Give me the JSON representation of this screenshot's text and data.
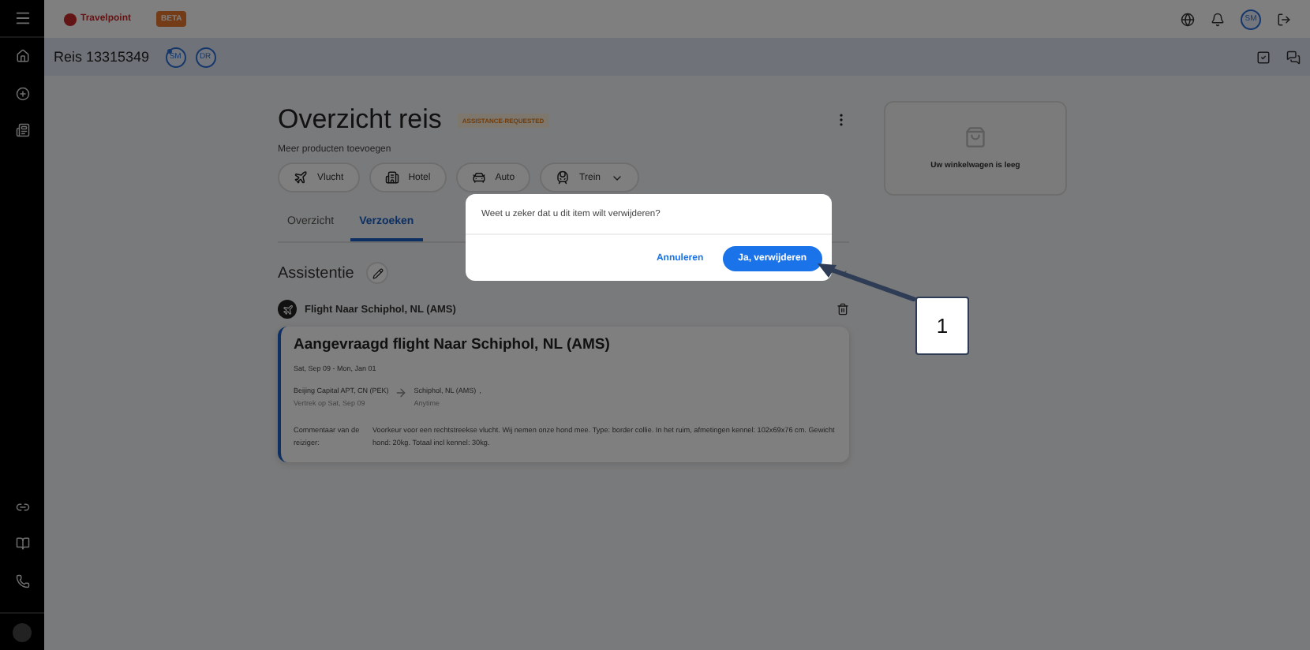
{
  "topbar": {
    "logo": "Travelpoint",
    "badge": "BETA",
    "user": "SM"
  },
  "trip": {
    "title": "Reis 13315349",
    "travellers": [
      {
        "initials": "SM",
        "unread": true
      },
      {
        "initials": "DR",
        "unread": false
      }
    ]
  },
  "overview": {
    "title": "Overzicht reis",
    "status": "ASSISTANCE-REQUESTED",
    "add_label": "Meer producten toevoegen",
    "products": [
      {
        "kind": "flight",
        "label": "Vlucht",
        "dropdown": false
      },
      {
        "kind": "hotel",
        "label": "Hotel",
        "dropdown": false
      },
      {
        "kind": "car",
        "label": "Auto",
        "dropdown": false
      },
      {
        "kind": "train",
        "label": "Trein",
        "dropdown": true
      }
    ],
    "tabs": [
      {
        "label": "Overzicht",
        "selected": false
      },
      {
        "label": "Verzoeken",
        "selected": true
      }
    ]
  },
  "section": {
    "title": "Assistentie",
    "item_title": "Flight Naar Schiphol, NL (AMS)",
    "card": {
      "title": "Aangevraagd flight Naar Schiphol, NL (AMS)",
      "dates": "Sat, Sep 09 - Mon, Jan 01",
      "from": "Beijing Capital APT, CN (PEK)",
      "from_note": "Vertrek op Sat, Sep 09",
      "to": "Schiphol, NL (AMS)",
      "to_suffix": ",",
      "to_note": "Anytime",
      "comment_label": "Commentaar van de reiziger:",
      "comment": "Voorkeur voor een rechtstreekse vlucht. Wij nemen onze hond mee. Type: border collie. In het ruim, afmetingen kennel: 102x69x76 cm. Gewicht hond: 20kg. Totaal incl kennel: 30kg."
    }
  },
  "cart": {
    "empty_text": "Uw winkelwagen is leeg"
  },
  "dialog": {
    "message": "Weet u zeker dat u dit item wilt verwijderen?",
    "cancel": "Annuleren",
    "confirm": "Ja, verwijderen"
  },
  "annotation": {
    "label": "1"
  }
}
